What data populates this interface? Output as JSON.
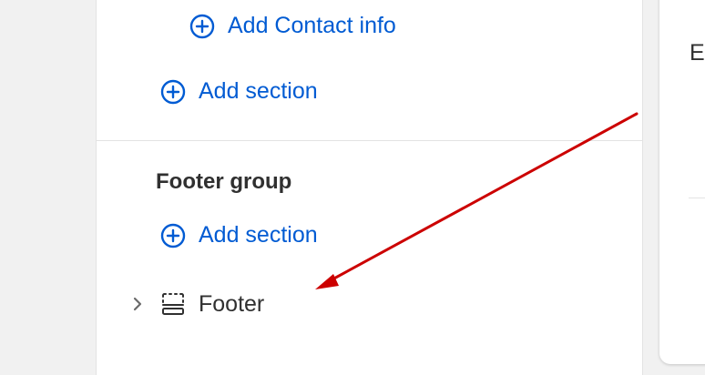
{
  "header_group": {
    "add_contact_label": "Add Contact info",
    "add_section_label": "Add section"
  },
  "footer_group": {
    "title": "Footer group",
    "add_section_label": "Add section",
    "items": [
      {
        "label": "Footer",
        "icon": "layout-footer-icon",
        "expand_icon": "chevron-right-icon"
      }
    ]
  },
  "right_panel": {
    "partial_text": "E"
  },
  "annotation": {
    "arrow_color": "#cc0000",
    "points_to": "Footer"
  },
  "colors": {
    "link": "#005bd3",
    "text": "#303030",
    "divider": "#e3e3e3",
    "background": "#f1f1f1"
  }
}
